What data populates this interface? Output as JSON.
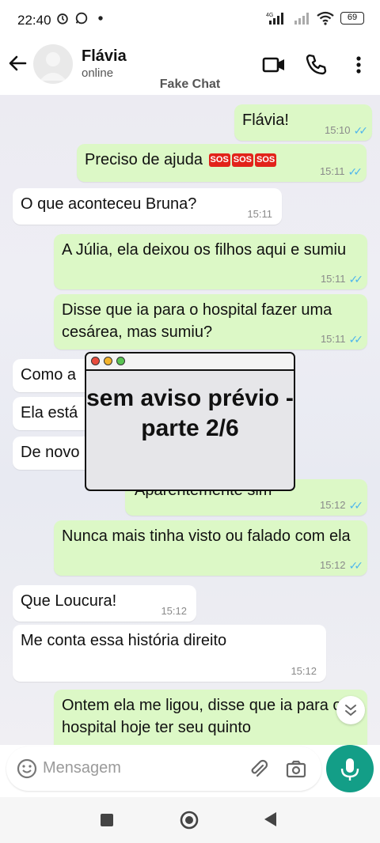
{
  "status_bar": {
    "time": "22:40",
    "network": "4G",
    "battery": "69"
  },
  "header": {
    "contact_name": "Flávia",
    "contact_status": "online",
    "watermark": "Fake Chat"
  },
  "messages": [
    {
      "dir": "out",
      "text": "Flávia!",
      "time": "15:10",
      "ticks": true
    },
    {
      "dir": "out",
      "text": "Preciso de ajuda",
      "emoji": "SOS",
      "emoji_count": 3,
      "time": "15:11",
      "ticks": true
    },
    {
      "dir": "in",
      "text": "O que aconteceu Bruna?",
      "time": "15:11"
    },
    {
      "dir": "out",
      "text": "A Júlia, ela deixou os filhos aqui e sumiu",
      "time": "15:11",
      "ticks": true
    },
    {
      "dir": "out",
      "text": "Disse que ia para o hospital fazer uma cesárea, mas sumiu?",
      "time": "15:11",
      "ticks": true
    },
    {
      "dir": "in",
      "text": "Como a"
    },
    {
      "dir": "in",
      "text": "Ela está"
    },
    {
      "dir": "in",
      "text": "De novo"
    },
    {
      "dir": "out",
      "text": "Aparentemente sim",
      "time": "15:12",
      "ticks": true
    },
    {
      "dir": "out",
      "text": "Nunca mais tinha visto ou falado com ela",
      "time": "15:12",
      "ticks": true
    },
    {
      "dir": "in",
      "text": "Que Loucura!",
      "time": "15:12"
    },
    {
      "dir": "in",
      "text": "Me conta essa história direito",
      "time": "15:12"
    },
    {
      "dir": "out",
      "text": "Ontem ela me ligou, disse que ia para o hospital hoje ter seu quinto"
    }
  ],
  "overlay": {
    "text": "sem aviso prévio - parte 2/6"
  },
  "input": {
    "placeholder": "Mensagem"
  },
  "colors": {
    "outgoing": "#dcf8c6",
    "incoming": "#ffffff",
    "accent": "#139e87",
    "ticks": "#4fb6ec",
    "sos": "#e2231a"
  },
  "icons": [
    "back-arrow-icon",
    "video-call-icon",
    "phone-icon",
    "more-vert-icon",
    "emoji-icon",
    "attach-icon",
    "camera-icon",
    "mic-icon",
    "chevron-down-icon"
  ]
}
